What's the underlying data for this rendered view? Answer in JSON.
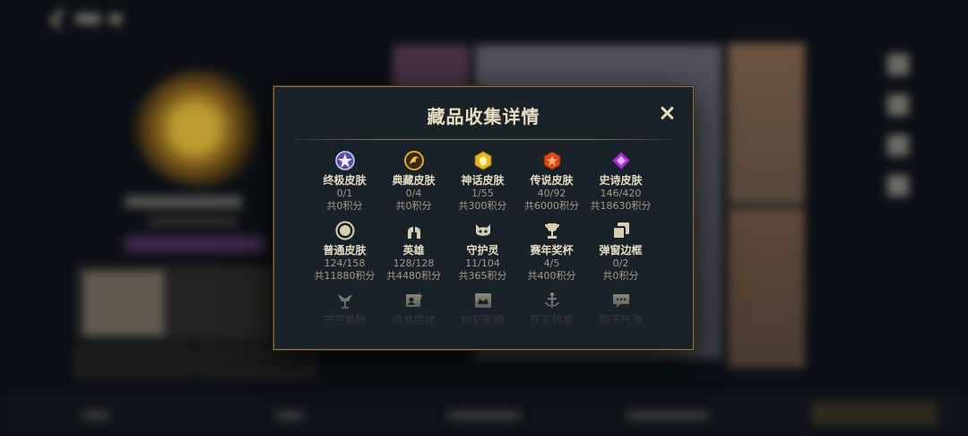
{
  "modal": {
    "title": "藏品收集详情",
    "close_label": "×"
  },
  "categories": [
    {
      "name": "终极皮肤",
      "count": "0/1",
      "points": "共0积分",
      "icon": "ultimate-skin-icon",
      "color": "#b7a6e6"
    },
    {
      "name": "典藏皮肤",
      "count": "0/4",
      "points": "共0积分",
      "icon": "collection-skin-icon",
      "color": "#e0a53a"
    },
    {
      "name": "神话皮肤",
      "count": "1/55",
      "points": "共300积分",
      "icon": "mythic-skin-icon",
      "color": "#e6b820"
    },
    {
      "name": "传说皮肤",
      "count": "40/92",
      "points": "共6000积分",
      "icon": "legendary-skin-icon",
      "color": "#e05a1e"
    },
    {
      "name": "史诗皮肤",
      "count": "146/420",
      "points": "共18630积分",
      "icon": "epic-skin-icon",
      "color": "#b040d0"
    },
    {
      "name": "普通皮肤",
      "count": "124/158",
      "points": "共11880积分",
      "icon": "normal-skin-icon",
      "color": "#d8cfb3"
    },
    {
      "name": "英雄",
      "count": "128/128",
      "points": "共4480积分",
      "icon": "hero-helmet-icon",
      "color": "#d8cfb3"
    },
    {
      "name": "守护灵",
      "count": "11/104",
      "points": "共365积分",
      "icon": "guardian-spirit-icon",
      "color": "#d8cfb3"
    },
    {
      "name": "赛年奖杯",
      "count": "4/5",
      "points": "共400积分",
      "icon": "trophy-icon",
      "color": "#d8cfb3"
    },
    {
      "name": "弹窗边框",
      "count": "0/2",
      "points": "共0积分",
      "icon": "popup-frame-icon",
      "color": "#d8cfb3"
    },
    {
      "name": "守卫装扮",
      "icon": "ward-skin-icon",
      "color": "#8f8878"
    },
    {
      "name": "信息底纹",
      "icon": "info-pattern-icon",
      "color": "#8f8878"
    },
    {
      "name": "炫彩昵称",
      "icon": "colorful-nickname-icon",
      "color": "#8f8878"
    },
    {
      "name": "歼灭效果",
      "icon": "annihilation-effect-icon",
      "color": "#8f8878"
    },
    {
      "name": "聊天气泡",
      "icon": "chat-bubble-icon",
      "color": "#8f8878"
    }
  ]
}
